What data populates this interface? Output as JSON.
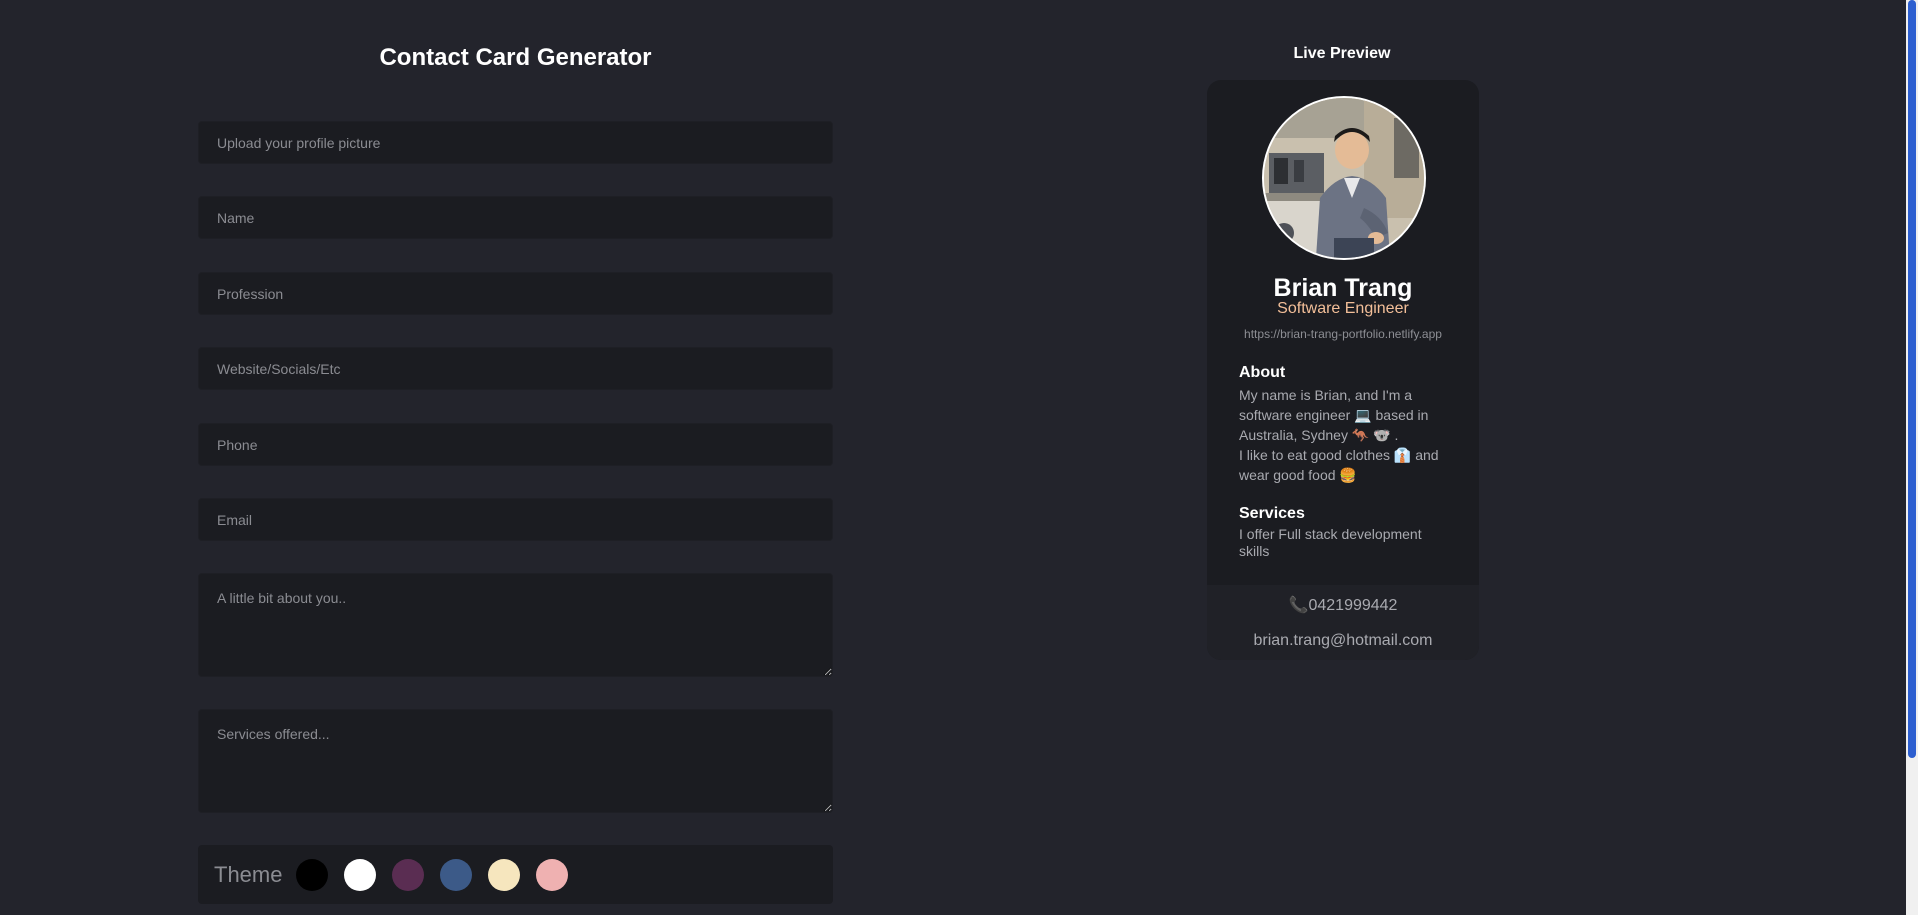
{
  "form": {
    "title": "Contact Card Generator",
    "upload_placeholder": "Upload your profile picture",
    "name_placeholder": "Name",
    "profession_placeholder": "Profession",
    "website_placeholder": "Website/Socials/Etc",
    "phone_placeholder": "Phone",
    "email_placeholder": "Email",
    "about_placeholder": "A little bit about you..",
    "services_placeholder": "Services offered...",
    "theme_label": "Theme",
    "theme_colors": [
      "#000000",
      "#ffffff",
      "#5a2d52",
      "#3c5a88",
      "#f6e6be",
      "#efb1b1"
    ]
  },
  "preview": {
    "title": "Live Preview",
    "name": "Brian Trang",
    "profession": "Software Engineer",
    "website": "https://brian-trang-portfolio.netlify.app",
    "about_heading": "About",
    "about_line1": "My name is Brian, and I'm a software engineer 💻 based in Australia, Sydney 🦘 🐨 .",
    "about_line2": "I like to eat good clothes 👔 and wear good food 🍔",
    "services_heading": "Services",
    "services_text": "I offer Full stack development skills",
    "phone_icon": "📞",
    "phone": "0421999442",
    "email": "brian.trang@hotmail.com",
    "profession_color": "#f3bf99"
  }
}
